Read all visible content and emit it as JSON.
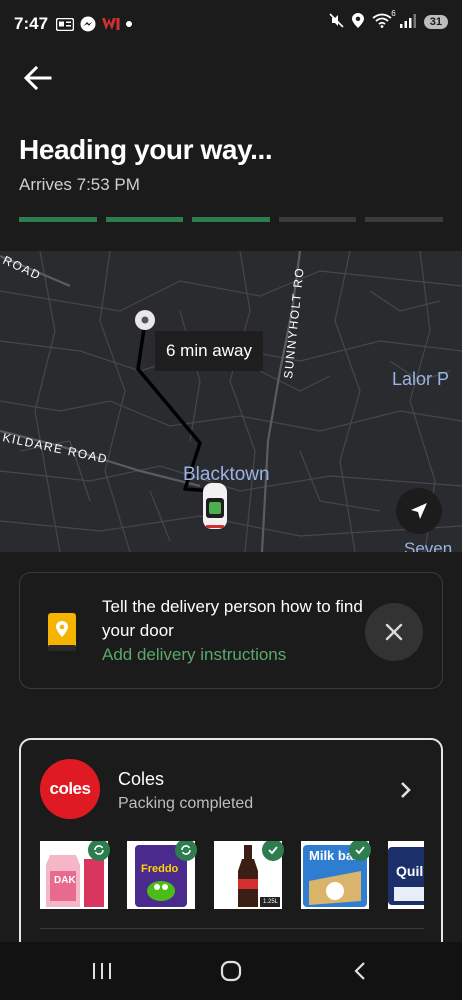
{
  "status_bar": {
    "time": "7:47",
    "icons": [
      "news-icon",
      "messenger-icon",
      "westpac-icon",
      "dot-icon"
    ],
    "right_icons": [
      "mute-icon",
      "location-icon",
      "wifi-icon",
      "signal-icon"
    ],
    "wifi_label": "6",
    "battery": "31"
  },
  "header": {
    "title": "Heading your way...",
    "eta": "Arrives 7:53 PM",
    "progress_steps_total": 5,
    "progress_steps_done": 3,
    "accent_color": "#2e7d4f"
  },
  "map": {
    "eta_label": "6 min away",
    "labels": {
      "road_top_left": "ROAD",
      "sunnyholt": "SUNNYHOLT RO",
      "kildare": "KILDARE ROAD",
      "blacktown": "Blacktown",
      "lalor": "Lalor P",
      "seven": "Seven"
    }
  },
  "instructions": {
    "title": "Tell the delivery person how to find your door",
    "link": "Add delivery instructions",
    "link_color": "#5aa86a"
  },
  "store": {
    "logo_text": "coles",
    "brand_color": "#e01a22",
    "name": "Coles",
    "status": "Packing completed",
    "products": [
      {
        "label": "DAK",
        "state": "refresh"
      },
      {
        "label": "Freddo",
        "state": "refresh"
      },
      {
        "label": "1.25L",
        "state": "check"
      },
      {
        "label": "Milk bar",
        "state": "check"
      },
      {
        "label": "Quil",
        "state": "none"
      }
    ]
  },
  "nav": {
    "buttons": [
      "recents-icon",
      "home-icon",
      "back-icon"
    ]
  }
}
